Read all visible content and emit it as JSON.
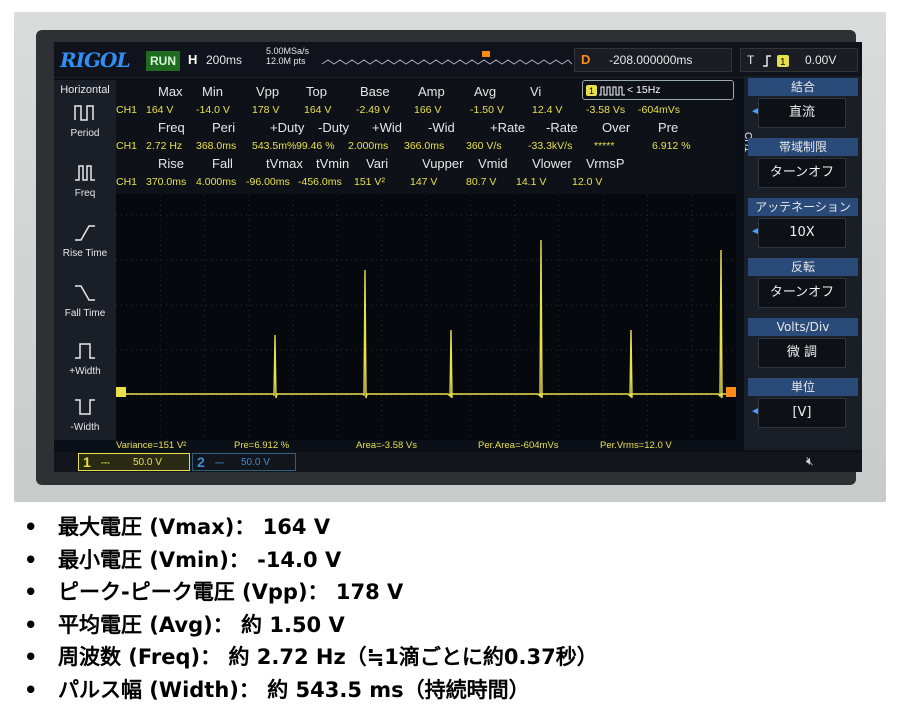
{
  "scope": {
    "brand": "RIGOL",
    "status": "RUN",
    "horizontal": {
      "label": "H",
      "value": "200ms"
    },
    "sample": {
      "rate": "5.00MSa/s",
      "points": "12.0M pts"
    },
    "trigger_delay": {
      "label": "D",
      "value": "-208.000000ms"
    },
    "trigger": {
      "label": "T",
      "value": "0.00V"
    },
    "left_menu": {
      "title": "Horizontal",
      "items": [
        {
          "label": "Period",
          "icon": "period-icon"
        },
        {
          "label": "Freq",
          "icon": "freq-icon"
        },
        {
          "label": "Rise Time",
          "icon": "rise-time-icon"
        },
        {
          "label": "Fall Time",
          "icon": "fall-time-icon"
        },
        {
          "label": "+Width",
          "icon": "pos-width-icon"
        },
        {
          "label": "-Width",
          "icon": "neg-width-icon"
        }
      ]
    },
    "freq_counter": "< 15Hz",
    "measurements": {
      "headers1": [
        "Max",
        "Min",
        "Vpp",
        "Top",
        "Base",
        "Amp",
        "Avg",
        "Vi"
      ],
      "row1": [
        "CH1",
        "164 V",
        "-14.0 V",
        "178 V",
        "164 V",
        "-2.49 V",
        "166 V",
        "-1.50 V",
        "12.4 V",
        "-3.58 Vs",
        "-604mVs"
      ],
      "headers2": [
        "Freq",
        "Peri",
        "+Duty",
        "-Duty",
        "+Wid",
        "-Wid",
        "+Rate",
        "-Rate",
        "Over",
        "Pre"
      ],
      "row2": [
        "CH1",
        "2.72 Hz",
        "368.0ms",
        "543.5m%",
        "99.46 %",
        "2.000ms",
        "366.0ms",
        "360 V/s",
        "-33.3kV/s",
        "*****",
        "6.912 %"
      ],
      "headers3": [
        "Rise",
        "Fall",
        "tVmax",
        "tVmin",
        "Vari",
        "Vupper",
        "Vmid",
        "Vlower",
        "VrmsP"
      ],
      "row3": [
        "CH1",
        "370.0ms",
        "4.000ms",
        "-96.00ms",
        "-456.0ms",
        "151 V²",
        "147 V",
        "80.7 V",
        "14.1 V",
        "12.0 V"
      ]
    },
    "stats": [
      "Variance=151 V²",
      "Pre=6.912 %",
      "Area=-3.58 Vs",
      "Per.Area=-604mVs",
      "Per.Vrms=12.0 V"
    ],
    "channel1": {
      "num": "1",
      "value": "50.0 V"
    },
    "channel2": {
      "num": "2",
      "value": "50.0 V"
    },
    "right_menu": {
      "side_label": "CH1",
      "items": [
        {
          "title": "結合",
          "value": "直流"
        },
        {
          "title": "帯域制限",
          "value": "ターンオフ"
        },
        {
          "title": "アッテネーション",
          "value": "10X"
        },
        {
          "title": "反転",
          "value": "ターンオフ"
        },
        {
          "title": "Volts/Div",
          "value": "微 調"
        },
        {
          "title": "単位",
          "value": "[V]"
        }
      ]
    },
    "colors": {
      "trace": "#e8e04b",
      "ch2": "#3c8fd0",
      "menu_title": "#2a4a7a",
      "trigger": "#ff8c1a"
    }
  },
  "bullets": [
    "最大電圧 (Vmax)： 164 V",
    "最小電圧 (Vmin)： -14.0 V",
    "ピーク-ピーク電圧 (Vpp)： 178 V",
    "平均電圧 (Avg)： 約 1.50 V",
    "周波数 (Freq)： 約 2.72 Hz（≒1滴ごとに約0.37秒）",
    "パルス幅 (Width)： 約 543.5 ms（持続時間）"
  ],
  "bullet_symbol": "•"
}
